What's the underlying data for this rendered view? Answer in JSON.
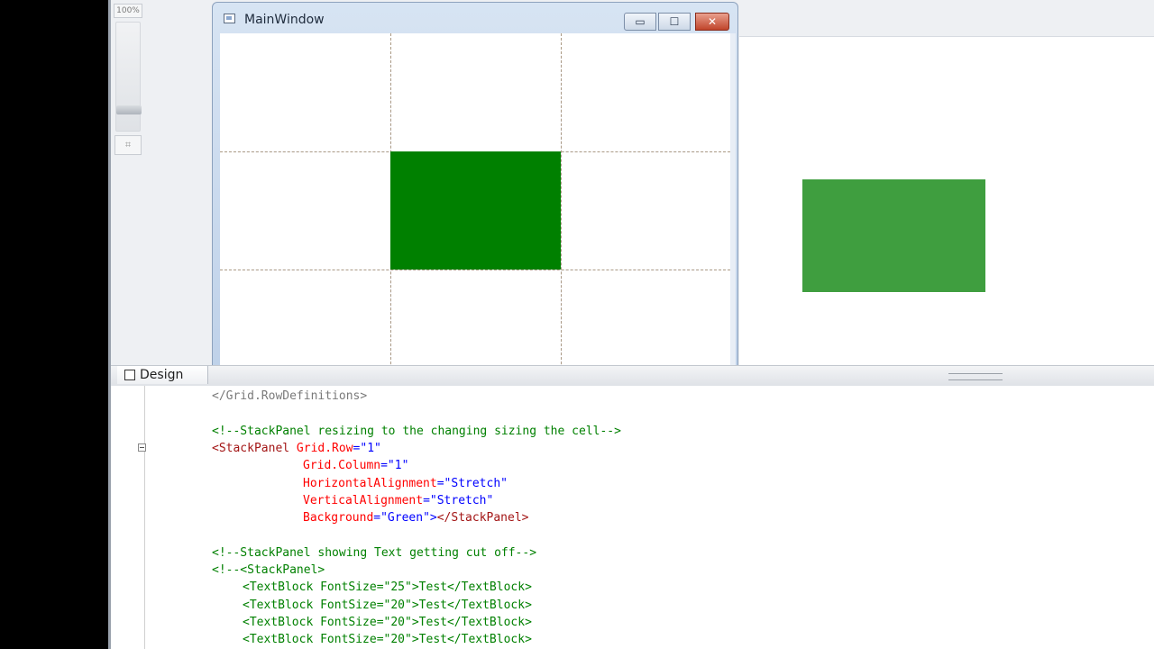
{
  "zoom": {
    "label": "100%",
    "fit_icon": "fit-to-screen-icon"
  },
  "window": {
    "title": "MainWindow",
    "min_glyph": "▭",
    "max_glyph": "☐",
    "close_glyph": "✕"
  },
  "tabs": {
    "design_label": "Design"
  },
  "code": {
    "line0": "</Grid.RowDefinitions>",
    "line1": "<!--StackPanel resizing to the changing sizing the cell-->",
    "line2_tag": "<StackPanel ",
    "line2_attr": "Grid.Row",
    "line2_val": "=\"1\"",
    "line3_attr": "Grid.Column",
    "line3_val": "=\"1\"",
    "line4_attr": "HorizontalAlignment",
    "line4_val": "=\"Stretch\"",
    "line5_attr": "VerticalAlignment",
    "line5_val": "=\"Stretch\"",
    "line6_attr": "Background",
    "line6_val": "=\"Green\">",
    "line6_close": "</StackPanel>",
    "line7": "<!--StackPanel showing Text getting cut off-->",
    "line8": "<!--<StackPanel>",
    "line9": "<TextBlock FontSize=\"25\">Test</TextBlock>",
    "line10": "<TextBlock FontSize=\"20\">Test</TextBlock>",
    "line11": "<TextBlock FontSize=\"20\">Test</TextBlock>",
    "line12": "<TextBlock FontSize=\"20\">Test</TextBlock>"
  },
  "colors": {
    "cell_fill": "#008000",
    "preview_fill": "#3f9e3f",
    "comment": "#008000",
    "attribute": "#ff0000",
    "value": "#0000ff"
  }
}
